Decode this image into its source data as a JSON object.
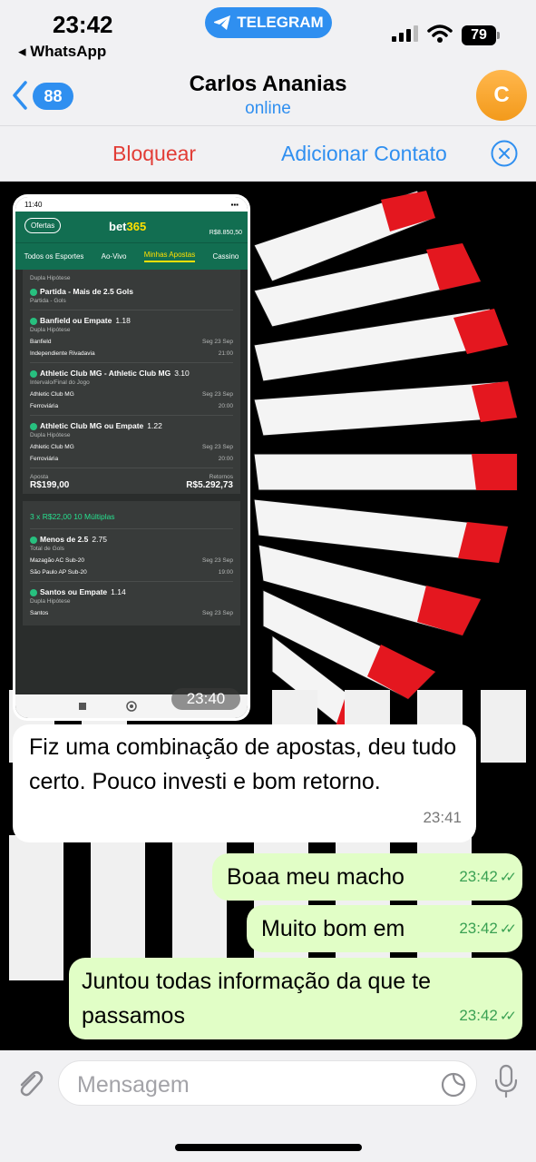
{
  "status_bar": {
    "time": "23:42",
    "back_app": "◂ WhatsApp",
    "pill_label": "TELEGRAM",
    "battery": "79",
    "icons": [
      "telegram-icon",
      "signal-icon",
      "wifi-icon",
      "battery-icon"
    ]
  },
  "header": {
    "unread_count": "88",
    "contact_name": "Carlos Ananias",
    "contact_status": "online",
    "avatar_letter": "C"
  },
  "actions": {
    "block": "Bloquear",
    "add_contact": "Adicionar Contato"
  },
  "messages": {
    "image": {
      "time": "23:40",
      "screenshot": {
        "status_time": "11:40",
        "ofertas": "Ofertas",
        "logo_a": "bet",
        "logo_b": "365",
        "balance": "R$8.850,50",
        "tabs": [
          "Todos os Esportes",
          "Ao-Vivo",
          "Minhas Apostas",
          "Cassino"
        ],
        "top_sub": "Dupla Hipótese",
        "s1_title": "Partida - Mais de 2.5 Gols",
        "s1_sub": "Partida - Gols",
        "s2_title": "Banfield ou Empate",
        "s2_odd": "1.18",
        "s2_sub": "Dupla Hipótese",
        "s2_home": "Banfield",
        "s2_away": "Independiente Rivadavia",
        "s2_date": "Seg 23 Sep",
        "s2_time": "21:00",
        "s3_title": "Athletic Club MG - Athletic Club MG",
        "s3_odd": "3.10",
        "s3_sub": "Intervalo/Final do Jogo",
        "s3_home": "Athletic Club MG",
        "s3_away": "Ferroviária",
        "s3_date": "Seg 23 Sep",
        "s3_time": "20:00",
        "s4_title": "Athletic Club MG ou Empate",
        "s4_odd": "1.22",
        "s4_sub": "Dupla Hipótese",
        "s4_home": "Athletic Club MG",
        "s4_away": "Ferroviária",
        "s4_date": "Seg 23 Sep",
        "s4_time": "20:00",
        "aposta_label": "Aposta",
        "aposta_value": "R$199,00",
        "retornos_label": "Retornos",
        "retornos_value": "R$5.292,73",
        "multi_header": "3 x R$22,00 10 Múltiplas",
        "m1_title": "Menos de 2.5",
        "m1_odd": "2.75",
        "m1_sub": "Total de Gols",
        "m1_home": "Mazagão AC Sub-20",
        "m1_away": "São Paulo AP Sub-20",
        "m1_date": "Seg 23 Sep",
        "m1_time": "19:00",
        "m2_title": "Santos ou Empate",
        "m2_odd": "1.14",
        "m2_sub": "Dupla Hipótese",
        "m2_home": "Santos",
        "m2_date": "Seg 23 Sep"
      }
    },
    "incoming_text": "Fiz uma combinação de apostas, deu tudo certo. Pouco investi e bom retorno.",
    "incoming_time": "23:41",
    "outgoing": [
      {
        "text": "Boaa meu macho",
        "time": "23:42"
      },
      {
        "text": "Muito bom em",
        "time": "23:42"
      },
      {
        "text": "Juntou todas informação da que te passamos",
        "time": "23:42"
      }
    ]
  },
  "composer": {
    "placeholder": "Mensagem"
  },
  "colors": {
    "accent_blue": "#2f8ff0",
    "block_red": "#e23d36",
    "outgoing_bubble": "#e1fec6",
    "bet365_green": "#126e51"
  }
}
